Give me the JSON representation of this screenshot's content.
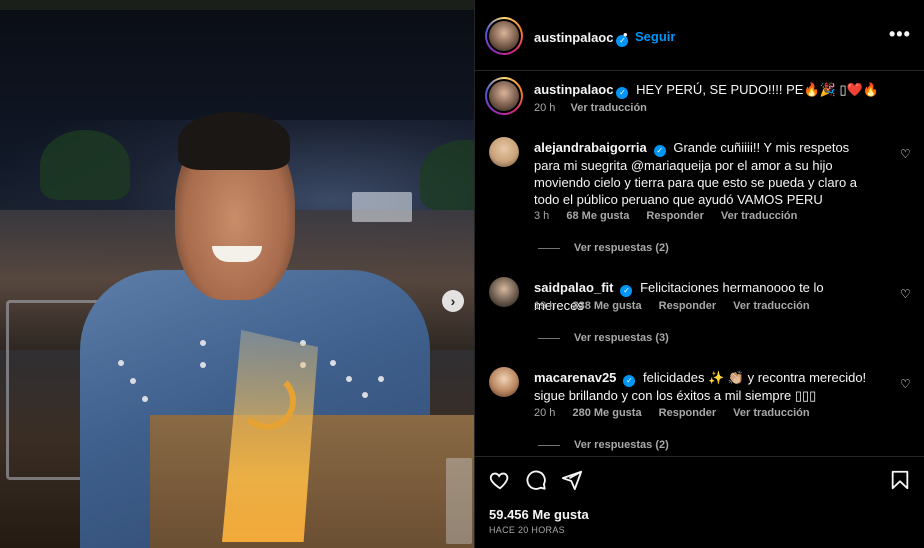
{
  "post": {
    "username": "austinpalaoc",
    "follow_label": "Seguir",
    "more_label": "•••",
    "next_label": "›"
  },
  "caption": {
    "username": "austinpalaoc",
    "text": "HEY PERÚ, SE PUDO!!!! PE🔥🎉 ▯❤️🔥",
    "time": "20 h",
    "translate": "Ver traducción"
  },
  "comments": [
    {
      "username": "alejandrabaigorria",
      "text": "Grande cuñiiii!! Y mis respetos para mi suegrita @mariaqueija por el amor a su hijo moviendo cielo y tierra para que esto se pueda y claro a todo el público peruano que ayudó VAMOS PERU",
      "time": "3 h",
      "likes": "68 Me gusta",
      "reply": "Responder",
      "translate": "Ver traducción",
      "replies": "Ver respuestas (2)",
      "avatar_color": "#c9a27a"
    },
    {
      "username": "saidpalao_fit",
      "text": "Felicitaciones hermanoooo te lo mereces",
      "time": "19 h",
      "likes": "338 Me gusta",
      "reply": "Responder",
      "translate": "Ver traducción",
      "replies": "Ver respuestas (3)",
      "avatar_color": "#6b5a4c"
    },
    {
      "username": "macarenav25",
      "text": "felicidades ✨ 👏🏼 y recontra merecido! sigue brillando y con los éxitos a mil siempre ▯▯▯",
      "time": "20 h",
      "likes": "280 Me gusta",
      "reply": "Responder",
      "translate": "Ver traducción",
      "replies": "Ver respuestas (2)",
      "avatar_color": "#b9855f"
    }
  ],
  "footer": {
    "likes": "59.456 Me gusta",
    "time_ago": "HACE 20 HORAS"
  },
  "icons": [
    "heart-icon",
    "comment-icon",
    "share-icon",
    "bookmark-icon",
    "more-icon",
    "verified-icon",
    "chevron-right-icon"
  ],
  "colors": {
    "accent": "#0095f6",
    "muted": "#a8a8a8",
    "background": "#000000"
  }
}
